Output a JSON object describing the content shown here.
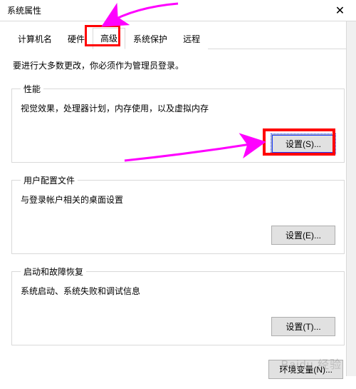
{
  "window": {
    "title": "系统属性",
    "close_glyph": "✕"
  },
  "tabs": [
    {
      "label": "计算机名"
    },
    {
      "label": "硬件"
    },
    {
      "label": "高级",
      "active": true
    },
    {
      "label": "系统保护"
    },
    {
      "label": "远程"
    }
  ],
  "intro": "要进行大多数更改，你必须作为管理员登录。",
  "groups": {
    "performance": {
      "legend": "性能",
      "desc": "视觉效果，处理器计划，内存使用，以及虚拟内存",
      "button": "设置(S)..."
    },
    "user_profiles": {
      "legend": "用户配置文件",
      "desc": "与登录帐户相关的桌面设置",
      "button": "设置(E)..."
    },
    "startup": {
      "legend": "启动和故障恢复",
      "desc": "系统启动、系统失败和调试信息",
      "button": "设置(T)..."
    }
  },
  "footer": {
    "env_vars": "环境变量(N)..."
  },
  "watermark": "Baidu 经验"
}
